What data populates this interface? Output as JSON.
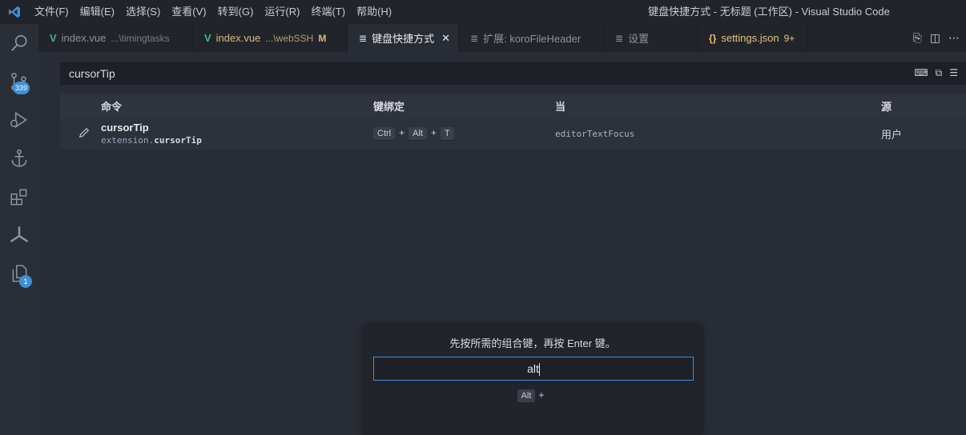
{
  "titlebar": {
    "menu": [
      "文件(F)",
      "编辑(E)",
      "选择(S)",
      "查看(V)",
      "转到(G)",
      "运行(R)",
      "终端(T)",
      "帮助(H)"
    ],
    "window_title": "键盘快捷方式 - 无标题 (工作区) - Visual Studio Code"
  },
  "activitybar": {
    "scm_badge": "339",
    "last_badge": "1"
  },
  "tabs": [
    {
      "label": "index.vue",
      "desc": "...\\timingtasks",
      "icon": "vue-icon"
    },
    {
      "label": "index.vue",
      "desc": "...\\webSSH",
      "status": "M",
      "icon": "vue-icon"
    },
    {
      "label": "键盘快捷方式",
      "icon": "keyboard-icon",
      "close": "✕"
    },
    {
      "label": "扩展: koroFileHeader",
      "icon": "extension-icon"
    },
    {
      "label": "设置",
      "icon": "settings-icon"
    },
    {
      "label": "settings.json",
      "status": "9+",
      "icon": "json-braces-icon",
      "glyph": "{}"
    }
  ],
  "search": {
    "value": "cursorTip"
  },
  "table": {
    "headers": {
      "command": "命令",
      "keybinding": "键绑定",
      "when": "当",
      "source": "源"
    },
    "rows": [
      {
        "title": "cursorTip",
        "id_prefix": "extension.",
        "id_name": "cursorTip",
        "keys": [
          "Ctrl",
          "Alt",
          "T"
        ],
        "key_sep": "+",
        "when": "editorTextFocus",
        "source": "用户"
      }
    ]
  },
  "widget": {
    "message": "先按所需的组合键，再按 Enter 键。",
    "input_value": "alt",
    "preview_key": "Alt",
    "preview_sep": "+"
  },
  "colors": {
    "accent": "#3e8fd8",
    "vue": "#42b883",
    "modified": "#d7ba7d"
  }
}
